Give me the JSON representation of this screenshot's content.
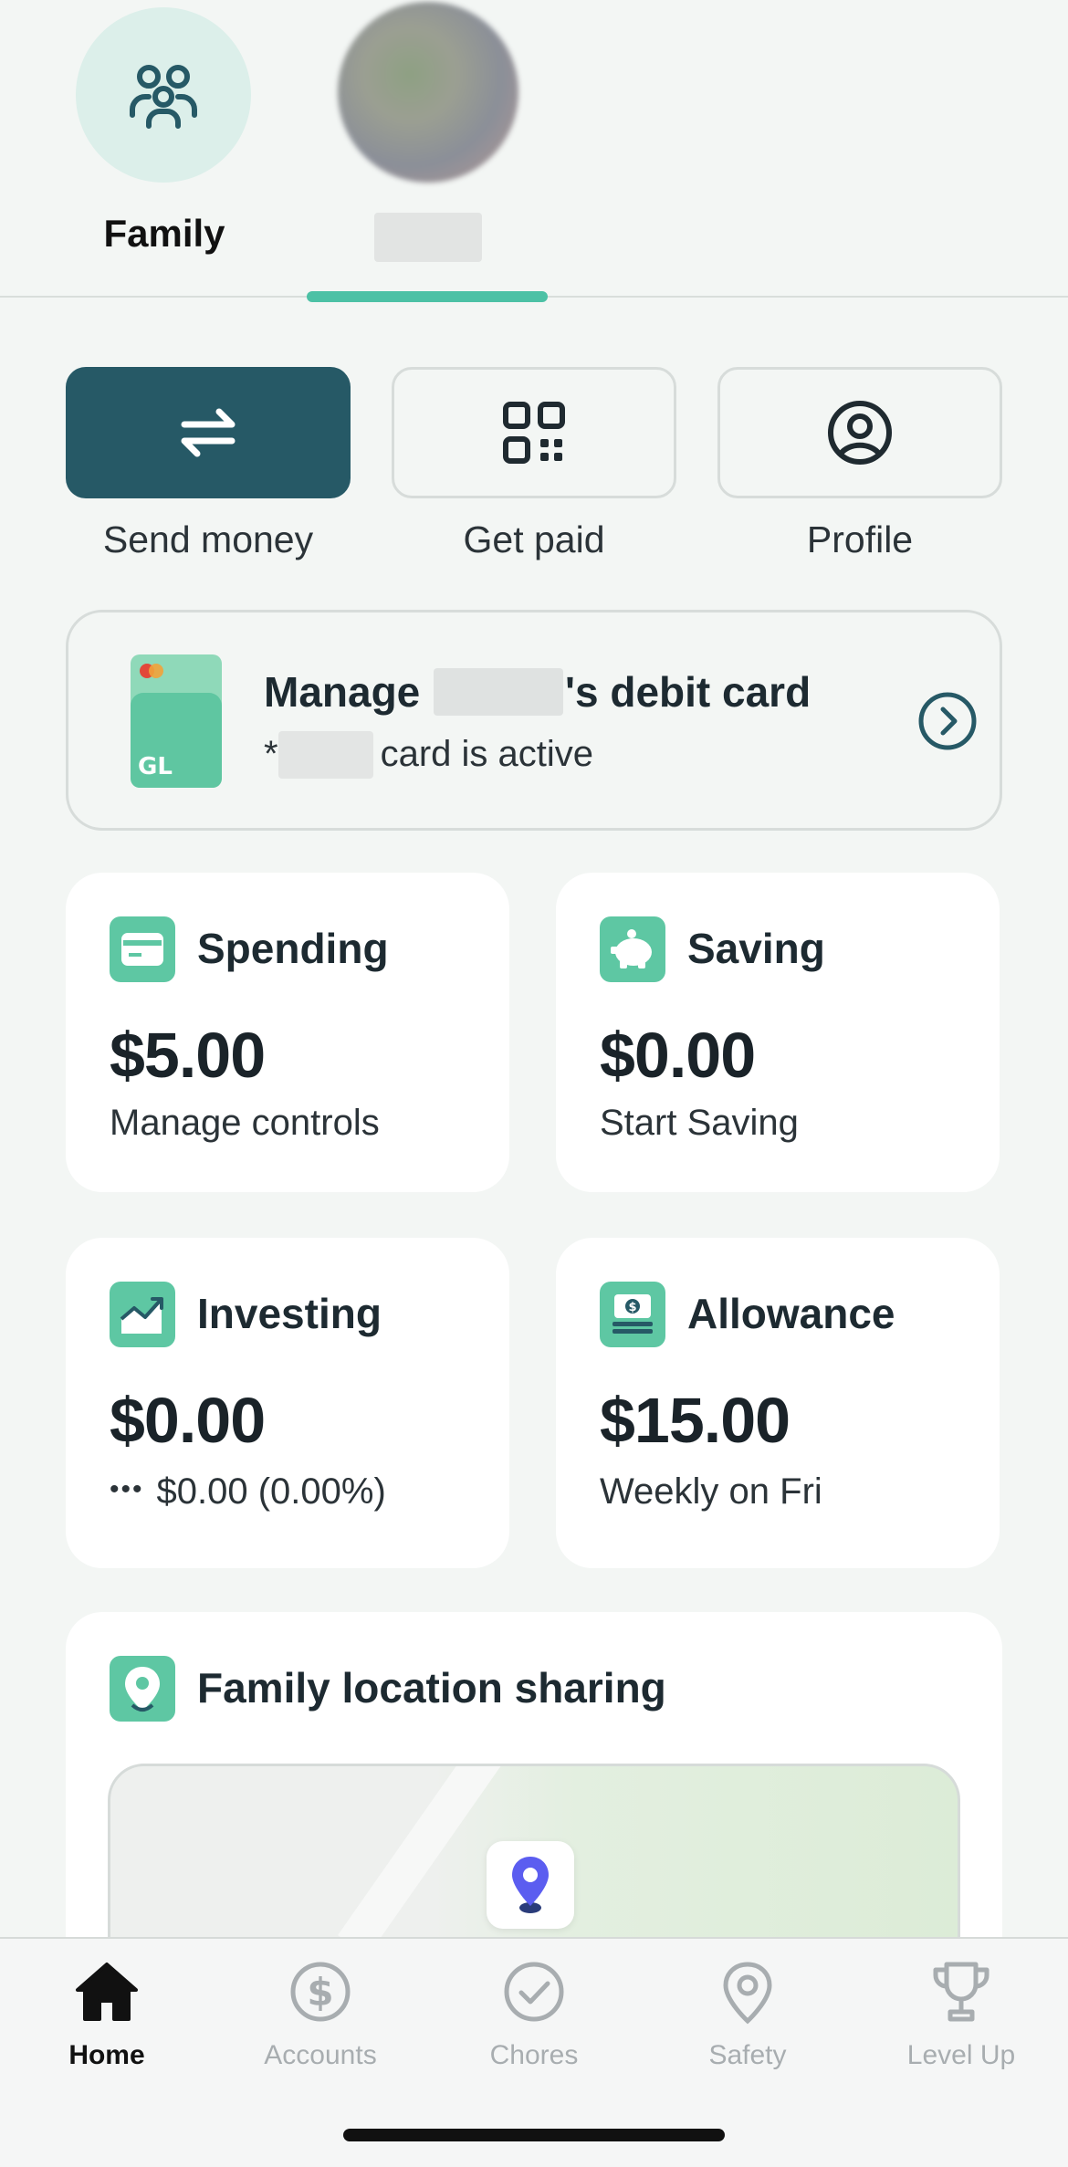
{
  "profiles": {
    "items": [
      {
        "label": "Family",
        "icon": "family-icon"
      },
      {
        "label": "",
        "icon": "avatar",
        "note_visible": "blurred"
      }
    ],
    "selected_index": 1
  },
  "quick_actions": [
    {
      "label": "Send money",
      "icon": "transfer-arrows-icon"
    },
    {
      "label": "Get paid",
      "icon": "qr-code-icon"
    },
    {
      "label": "Profile",
      "icon": "user-circle-icon"
    }
  ],
  "debit_card": {
    "title_prefix": "Manage",
    "title_suffix": "'s debit card",
    "status_prefix": "*",
    "status_suffix": "card is active",
    "card_badge": "GL"
  },
  "tiles": {
    "spending": {
      "title": "Spending",
      "amount": "$5.00",
      "sub": "Manage controls"
    },
    "saving": {
      "title": "Saving",
      "amount": "$0.00",
      "sub": "Start Saving"
    },
    "investing": {
      "title": "Investing",
      "amount": "$0.00",
      "sub": "$0.00 (0.00%)",
      "sub_prefix": "•••"
    },
    "allowance": {
      "title": "Allowance",
      "amount": "$15.00",
      "sub": "Weekly on Fri"
    }
  },
  "location": {
    "title": "Family location sharing"
  },
  "tabbar": [
    {
      "label": "Home",
      "icon": "home-icon",
      "active": true
    },
    {
      "label": "Accounts",
      "icon": "dollar-circle-icon",
      "active": false
    },
    {
      "label": "Chores",
      "icon": "check-circle-icon",
      "active": false
    },
    {
      "label": "Safety",
      "icon": "location-pin-icon",
      "active": false
    },
    {
      "label": "Level Up",
      "icon": "trophy-icon",
      "active": false
    }
  ],
  "colors": {
    "accent_teal": "#265966",
    "mint": "#5ec7a3",
    "indicator": "#4cc1a5",
    "background": "#f3f6f4"
  }
}
